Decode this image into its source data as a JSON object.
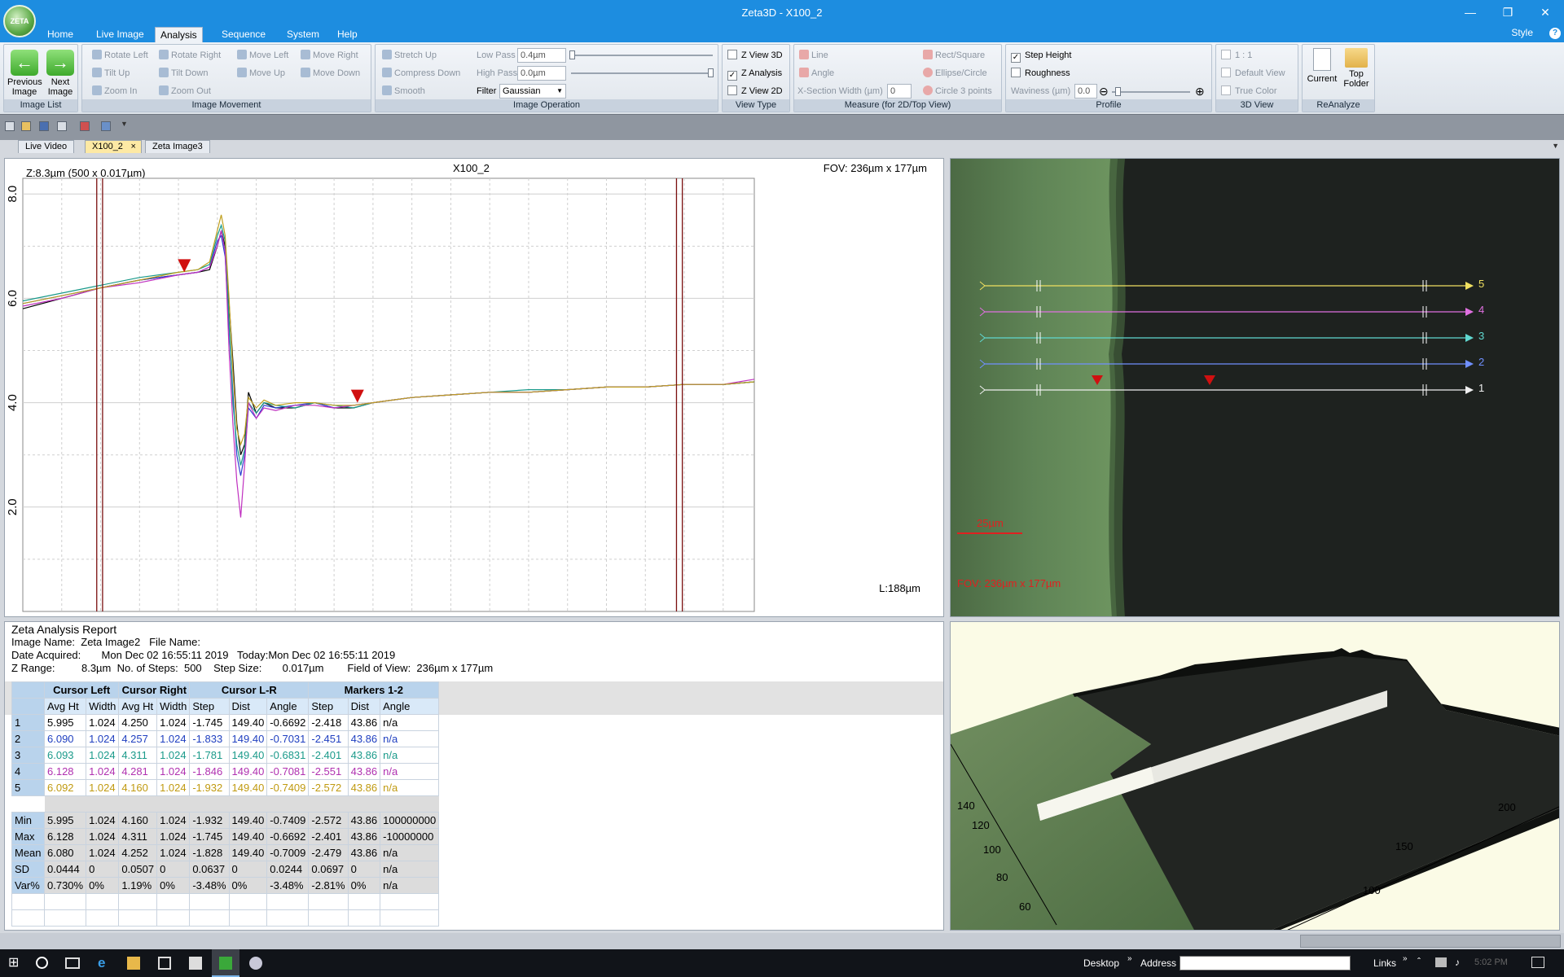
{
  "window": {
    "title": "Zeta3D - X100_2",
    "logo_text": "ZETA"
  },
  "menu": {
    "tabs": [
      "Home",
      "Live Image",
      "Analysis",
      "Sequence",
      "System",
      "Help"
    ],
    "active": "Analysis",
    "style_label": "Style"
  },
  "ribbon": {
    "image_list": {
      "label": "Image List",
      "previous": "Previous Image",
      "next": "Next Image"
    },
    "image_movement": {
      "label": "Image Movement",
      "rotate_left": "Rotate Left",
      "rotate_right": "Rotate Right",
      "tilt_up": "Tilt Up",
      "tilt_down": "Tilt Down",
      "zoom_in": "Zoom In",
      "zoom_out": "Zoom Out",
      "move_left": "Move Left",
      "move_right": "Move Right",
      "move_up": "Move Up",
      "move_down": "Move Down"
    },
    "image_operation": {
      "label": "Image Operation",
      "stretch_up": "Stretch Up",
      "compress_down": "Compress Down",
      "smooth": "Smooth",
      "low_pass_label": "Low Pass",
      "low_pass_value": "0.4µm",
      "high_pass_label": "High Pass",
      "high_pass_value": "0.0µm",
      "filter_label": "Filter",
      "filter_value": "Gaussian"
    },
    "view_type": {
      "label": "View Type",
      "z_view_3d": "Z View 3D",
      "z_analysis": "Z Analysis",
      "z_view_2d": "Z View 2D"
    },
    "measure": {
      "label": "Measure (for 2D/Top View)",
      "line": "Line",
      "angle": "Angle",
      "x_section_label": "X-Section Width (µm)",
      "x_section_value": "0",
      "rect": "Rect/Square",
      "ellipse": "Ellipse/Circle",
      "circle3": "Circle 3 points"
    },
    "profile": {
      "label": "Profile",
      "step_height": "Step Height",
      "roughness": "Roughness",
      "waviness_label": "Waviness (µm)",
      "waviness_value": "0.0"
    },
    "view3d": {
      "label": "3D View",
      "one_to_one": "1 : 1",
      "default_view": "Default View",
      "true_color": "True Color"
    },
    "reanalyze": {
      "label": "ReAnalyze",
      "current": "Current",
      "top_folder": "Top Folder"
    }
  },
  "doc_tabs": [
    "Live Video",
    "X100_2",
    "Zeta Image3"
  ],
  "graph": {
    "z_info": "Z:8.3µm (500 x 0.017µm)",
    "title": "X100_2",
    "fov": "FOV: 236µm x 177µm",
    "length": "L:188µm"
  },
  "chart_data": {
    "type": "line",
    "title": "X100_2",
    "xlim": [
      0,
      188
    ],
    "ylim": [
      0,
      8.3
    ],
    "x_ticks": [
      20,
      40,
      60,
      80,
      100,
      120,
      140,
      160,
      180
    ],
    "y_ticks": [
      2.0,
      4.0,
      6.0,
      8.0
    ],
    "grid": true,
    "cursors_left_x": [
      19,
      20.5
    ],
    "cursors_right_x": [
      168,
      169.5
    ],
    "markers": [
      {
        "x": 41.5,
        "y": 6.5
      },
      {
        "x": 86,
        "y": 4.0
      }
    ],
    "x": [
      0,
      10,
      20,
      30,
      40,
      45,
      48,
      50,
      51,
      52,
      53,
      54,
      55,
      56,
      57,
      58,
      60,
      62,
      65,
      70,
      75,
      80,
      85,
      90,
      95,
      100,
      110,
      120,
      130,
      140,
      150,
      160,
      170,
      180,
      188
    ],
    "series": [
      {
        "color": "#000000",
        "values": [
          5.8,
          6.0,
          6.2,
          6.35,
          6.45,
          6.5,
          6.55,
          7.0,
          7.3,
          7.0,
          5.9,
          4.8,
          3.6,
          3.0,
          3.2,
          4.2,
          3.8,
          4.0,
          3.9,
          3.9,
          4.0,
          3.9,
          3.9,
          4.0,
          4.05,
          4.1,
          4.15,
          4.2,
          4.2,
          4.25,
          4.3,
          4.3,
          4.35,
          4.35,
          4.4
        ]
      },
      {
        "color": "#2a3fd0",
        "values": [
          5.9,
          6.05,
          6.2,
          6.35,
          6.45,
          6.5,
          6.6,
          7.1,
          7.2,
          6.8,
          5.4,
          4.2,
          3.0,
          2.6,
          3.0,
          3.9,
          3.7,
          3.95,
          3.9,
          3.95,
          4.0,
          3.9,
          3.95,
          4.0,
          4.05,
          4.1,
          4.15,
          4.2,
          4.2,
          4.25,
          4.3,
          4.3,
          4.35,
          4.35,
          4.4
        ]
      },
      {
        "color": "#1a9a8a",
        "values": [
          5.95,
          6.1,
          6.25,
          6.4,
          6.5,
          6.55,
          6.65,
          7.2,
          7.4,
          7.1,
          5.6,
          4.0,
          3.2,
          2.8,
          3.1,
          4.0,
          3.8,
          4.0,
          3.95,
          3.9,
          4.0,
          3.95,
          3.9,
          4.0,
          4.05,
          4.1,
          4.15,
          4.2,
          4.25,
          4.25,
          4.3,
          4.3,
          4.35,
          4.35,
          4.4
        ]
      },
      {
        "color": "#c030c0",
        "values": [
          5.85,
          6.0,
          6.2,
          6.3,
          6.45,
          6.5,
          6.6,
          7.0,
          7.3,
          6.9,
          5.0,
          3.6,
          2.5,
          1.8,
          2.8,
          4.0,
          3.7,
          3.9,
          3.85,
          3.95,
          3.95,
          3.9,
          3.95,
          4.0,
          4.05,
          4.1,
          4.15,
          4.2,
          4.2,
          4.25,
          4.3,
          4.3,
          4.35,
          4.35,
          4.45
        ]
      },
      {
        "color": "#c0a020",
        "values": [
          5.9,
          6.05,
          6.2,
          6.35,
          6.5,
          6.55,
          6.7,
          7.3,
          7.6,
          7.2,
          6.0,
          4.6,
          3.5,
          3.2,
          3.4,
          4.1,
          3.9,
          4.05,
          3.95,
          4.0,
          4.0,
          3.95,
          3.95,
          4.0,
          4.05,
          4.1,
          4.15,
          4.2,
          4.2,
          4.25,
          4.3,
          4.3,
          4.35,
          4.35,
          4.4
        ]
      }
    ]
  },
  "image_view": {
    "scale": "25µm",
    "fov": "FOV: 236µm x 177µm",
    "line_labels": [
      "5",
      "4",
      "3",
      "2",
      "1"
    ],
    "line_colors": [
      "#f0e060",
      "#e070e0",
      "#60d8d0",
      "#7090ff",
      "#f0f0f0"
    ]
  },
  "report": {
    "title": "Zeta Analysis Report",
    "line1": "Image Name:  Zeta Image2   File Name:",
    "line2": "Date Acquired:       Mon Dec 02 16:55:11 2019   Today:Mon Dec 02 16:55:11 2019",
    "line3": "Z Range:         8.3µm  No. of Steps:  500    Step Size:       0.017µm        Field of View:  236µm x 177µm",
    "groups": [
      "Cursor Left",
      "Cursor Right",
      "Cursor L-R",
      "Markers 1-2"
    ],
    "columns": [
      "Avg Ht",
      "Width",
      "Avg Ht",
      "Width",
      "Step",
      "Dist",
      "Angle",
      "Step",
      "Dist",
      "Angle"
    ],
    "rows": [
      {
        "label": "1",
        "color": "#000000",
        "cells": [
          "5.995",
          "1.024",
          "4.250",
          "1.024",
          "-1.745",
          "149.40",
          "-0.6692",
          "-2.418",
          "43.86",
          "n/a"
        ]
      },
      {
        "label": "2",
        "color": "#1f3fc0",
        "cells": [
          "6.090",
          "1.024",
          "4.257",
          "1.024",
          "-1.833",
          "149.40",
          "-0.7031",
          "-2.451",
          "43.86",
          "n/a"
        ]
      },
      {
        "label": "3",
        "color": "#1a9a8a",
        "cells": [
          "6.093",
          "1.024",
          "4.311",
          "1.024",
          "-1.781",
          "149.40",
          "-0.6831",
          "-2.401",
          "43.86",
          "n/a"
        ]
      },
      {
        "label": "4",
        "color": "#b030b0",
        "cells": [
          "6.128",
          "1.024",
          "4.281",
          "1.024",
          "-1.846",
          "149.40",
          "-0.7081",
          "-2.551",
          "43.86",
          "n/a"
        ]
      },
      {
        "label": "5",
        "color": "#c09a10",
        "cells": [
          "6.092",
          "1.024",
          "4.160",
          "1.024",
          "-1.932",
          "149.40",
          "-0.7409",
          "-2.572",
          "43.86",
          "n/a"
        ]
      }
    ],
    "stats": [
      {
        "label": "Min",
        "cells": [
          "5.995",
          "1.024",
          "4.160",
          "1.024",
          "-1.932",
          "149.40",
          "-0.7409",
          "-2.572",
          "43.86",
          "100000000"
        ]
      },
      {
        "label": "Max",
        "cells": [
          "6.128",
          "1.024",
          "4.311",
          "1.024",
          "-1.745",
          "149.40",
          "-0.6692",
          "-2.401",
          "43.86",
          "-10000000"
        ]
      },
      {
        "label": "Mean",
        "cells": [
          "6.080",
          "1.024",
          "4.252",
          "1.024",
          "-1.828",
          "149.40",
          "-0.7009",
          "-2.479",
          "43.86",
          "n/a"
        ]
      },
      {
        "label": "SD",
        "cells": [
          "0.0444",
          "0",
          "0.0507",
          "0",
          "0.0637",
          "0",
          "0.0244",
          "0.0697",
          "0",
          "n/a"
        ]
      },
      {
        "label": "Var%",
        "cells": [
          "0.730%",
          "0%",
          "1.19%",
          "0%",
          "-3.48%",
          "0%",
          "-3.48%",
          "-2.81%",
          "0%",
          "n/a"
        ]
      }
    ]
  },
  "view3d": {
    "axis_labels": [
      "140",
      "120",
      "100",
      "80",
      "60",
      "200",
      "150",
      "100"
    ]
  },
  "taskbar": {
    "desktop": "Desktop",
    "address": "Address",
    "links": "Links",
    "time": "5:02 PM"
  }
}
